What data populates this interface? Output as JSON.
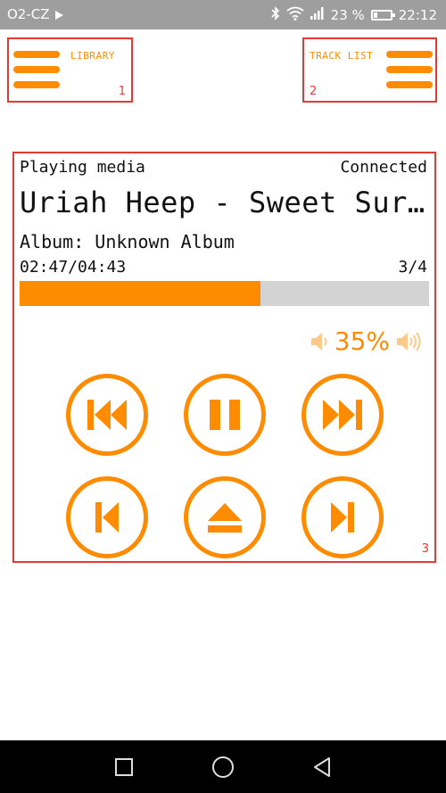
{
  "status_bar": {
    "carrier": "O2-CZ",
    "battery_text": "23 %",
    "battery_level": 0.23,
    "time": "22:12",
    "icons": [
      "play-icon",
      "bluetooth-icon",
      "wifi-icon",
      "signal-icon",
      "battery-icon"
    ]
  },
  "top_buttons": {
    "library": {
      "label": "LIBRARY",
      "badge": "1",
      "icon": "hamburger-icon"
    },
    "track_list": {
      "label": "TRACK LIST",
      "badge": "2",
      "icon": "hamburger-icon"
    }
  },
  "player": {
    "badge": "3",
    "status": "Playing media",
    "connection": "Connected",
    "title": "Uriah Heep - Sweet Surrender",
    "album": "Album: Unknown Album",
    "time": "02:47/04:43",
    "track_count": "3/4",
    "progress_fraction": 0.588,
    "volume": "35%",
    "controls": [
      "rewind",
      "pause",
      "fast-forward",
      "previous",
      "eject",
      "next"
    ]
  },
  "nav_bar": {
    "icons": [
      "recents-square-icon",
      "home-circle-icon",
      "back-triangle-icon"
    ]
  },
  "colors": {
    "accent": "#ff8c00",
    "annotation": "#e53935",
    "status_bar": "#9e9e9e",
    "progress_track": "#d3d3d3"
  }
}
